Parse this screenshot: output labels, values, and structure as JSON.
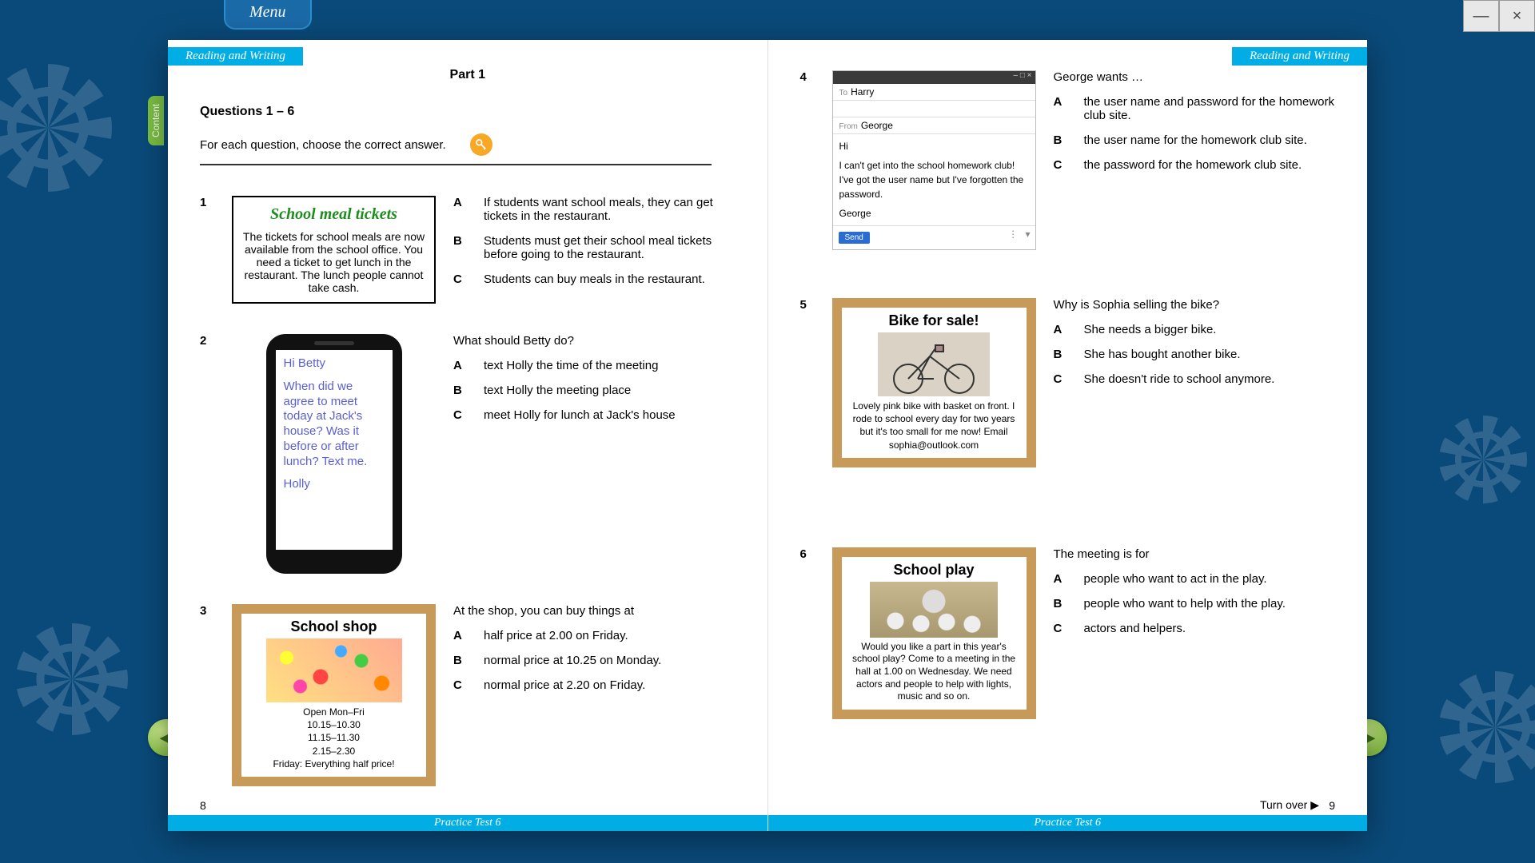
{
  "window": {
    "minimize": "—",
    "close": "×"
  },
  "menu_label": "Menu",
  "content_tab_label": "Content",
  "section_tab": "Reading and Writing",
  "part_title": "Part 1",
  "qrange": "Questions 1 – 6",
  "instruction": "For each question, choose the correct answer.",
  "questions": {
    "q1": {
      "num": "1",
      "notice_title": "School meal tickets",
      "notice_body": "The tickets for school meals are now available from the school office. You need a ticket to get lunch in the restaurant. The lunch people cannot take cash.",
      "opts": {
        "A": "If students want school meals, they can get tickets in the restaurant.",
        "B": "Students must get their school meal tickets before going to the restaurant.",
        "C": "Students can buy meals in the restaurant."
      }
    },
    "q2": {
      "num": "2",
      "phone_greeting": "Hi Betty",
      "phone_body": "When did we agree to meet today at Jack's house? Was it before or after lunch? Text me.",
      "phone_sign": "Holly",
      "prompt": "What should Betty do?",
      "opts": {
        "A": "text Holly the time of the meeting",
        "B": "text Holly the meeting place",
        "C": "meet Holly for lunch at Jack's house"
      }
    },
    "q3": {
      "num": "3",
      "title": "School shop",
      "line_open": "Open Mon–Fri",
      "times1": "10.15–10.30",
      "times2": "11.15–11.30",
      "times3": "2.15–2.30",
      "line_friday": "Friday: Everything half price!",
      "prompt": "At the shop, you can buy things at",
      "opts": {
        "A": "half price at 2.00 on Friday.",
        "B": "normal price at 10.25 on Monday.",
        "C": "normal price at 2.20 on Friday."
      }
    },
    "q4": {
      "num": "4",
      "to_lbl": "To",
      "to_val": "Harry",
      "from_lbl": "From",
      "from_val": "George",
      "body_hi": "Hi",
      "body_text": "I can't get into the school homework club! I've got the user name but I've forgotten the password.",
      "body_sign": "George",
      "send": "Send",
      "prompt": "George wants …",
      "opts": {
        "A": "the user name and password for the homework club site.",
        "B": "the user name for the homework club site.",
        "C": "the password for the homework club site."
      }
    },
    "q5": {
      "num": "5",
      "title": "Bike for sale!",
      "body": "Lovely pink bike with basket on front. I rode to school every day for two years but it's too small for me now! Email sophia@outlook.com",
      "prompt": "Why is Sophia selling the bike?",
      "opts": {
        "A": "She needs a bigger bike.",
        "B": "She has bought another bike.",
        "C": "She doesn't ride to school anymore."
      }
    },
    "q6": {
      "num": "6",
      "title": "School play",
      "body": "Would you like a part in this year's school play? Come to a meeting in the hall at 1.00 on Wednesday. We need actors and people to help with lights, music and so on.",
      "prompt": "The meeting is for",
      "opts": {
        "A": "people who want to act in the play.",
        "B": "people who want to help with the play.",
        "C": "actors and helpers."
      }
    }
  },
  "footer": {
    "test_name": "Practice Test 6",
    "left_page": "8",
    "right_page": "9",
    "turn_over": "Turn over ▶"
  }
}
